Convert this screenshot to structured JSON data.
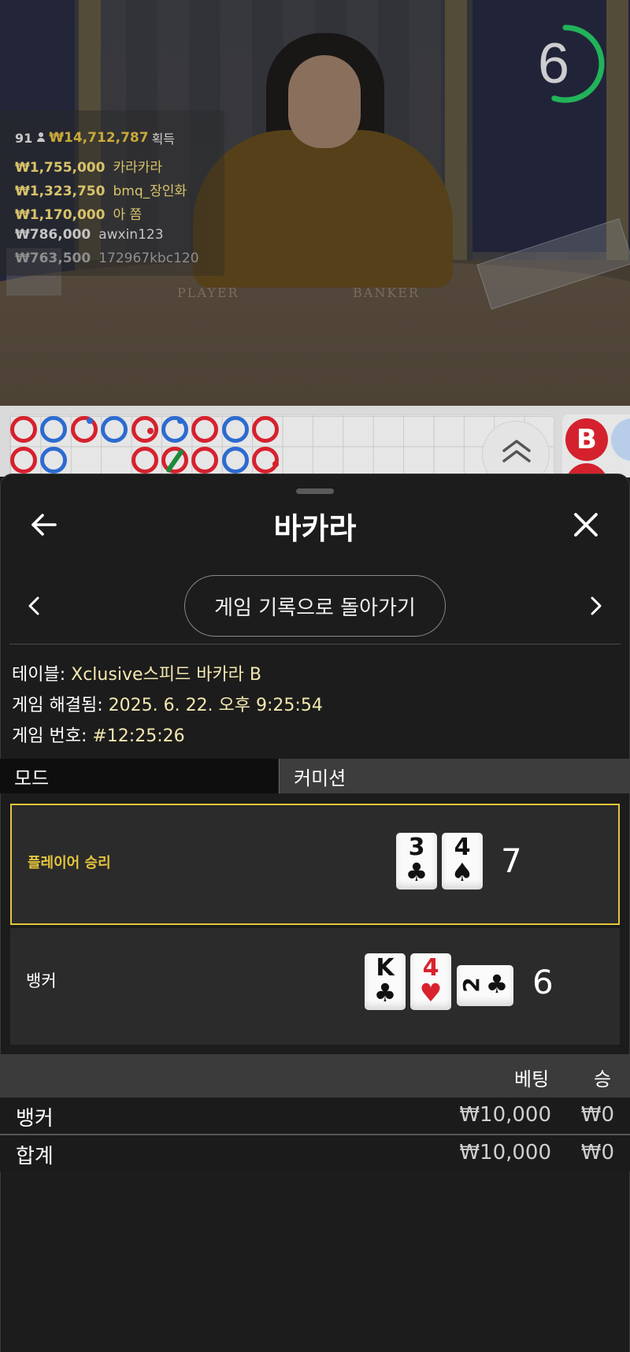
{
  "video": {
    "countdown": "6",
    "countdown_fraction": 0.55,
    "felt_player": "PLAYER",
    "felt_banker": "BANKER",
    "winners_total": {
      "players_count": "91",
      "amount": "₩14,712,787",
      "label": "획득"
    },
    "winners": [
      {
        "amount": "₩1,755,000",
        "name": "카라카라",
        "color": "#d8c36a"
      },
      {
        "amount": "₩1,323,750",
        "name": "bmq_장인화",
        "color": "#d8c36a"
      },
      {
        "amount": "₩1,170,000",
        "name": "아 쫌",
        "color": "#d8c36a"
      },
      {
        "amount": "₩786,000",
        "name": "awxin123",
        "color": "#c4c4c4"
      },
      {
        "amount": "₩763,500",
        "name": "172967kbc120",
        "color": "#8e8e8e"
      }
    ]
  },
  "roadmap": {
    "big_road_badge": "B"
  },
  "sheet": {
    "title": "바카라",
    "history_button": "게임 기록으로 돌아가기",
    "table_label": "테이블: ",
    "table_value": "Xclusive스피드 바카라 B",
    "resolved_label": "게임 해결됨: ",
    "resolved_value": "2025. 6. 22. 오후 9:25:54",
    "game_no_label": "게임 번호: ",
    "game_no_value": "#12:25:26",
    "tab_mode": "모드",
    "tab_commission": "커미션",
    "player": {
      "label": "플레이어 승리",
      "cards": [
        {
          "rank": "3",
          "suit": "♣",
          "color": "#111111"
        },
        {
          "rank": "4",
          "suit": "♠",
          "color": "#111111"
        }
      ],
      "score": "7"
    },
    "banker": {
      "label": "뱅커",
      "cards": [
        {
          "rank": "K",
          "suit": "♣",
          "color": "#111111"
        },
        {
          "rank": "4",
          "suit": "♥",
          "color": "#d8232e"
        },
        {
          "rank": "2",
          "suit": "♣",
          "color": "#111111"
        }
      ],
      "score": "6"
    },
    "bets": {
      "header_bet": "베팅",
      "header_win": "승",
      "rows": [
        {
          "name": "뱅커",
          "bet": "₩10,000",
          "win": "₩0"
        },
        {
          "name": "합계",
          "bet": "₩10,000",
          "win": "₩0"
        }
      ]
    }
  },
  "colors": {
    "accent_gold": "#e5c53c",
    "banker_red": "#d6212e",
    "player_blue": "#2d6bd0",
    "timer_green": "#22b35a"
  }
}
